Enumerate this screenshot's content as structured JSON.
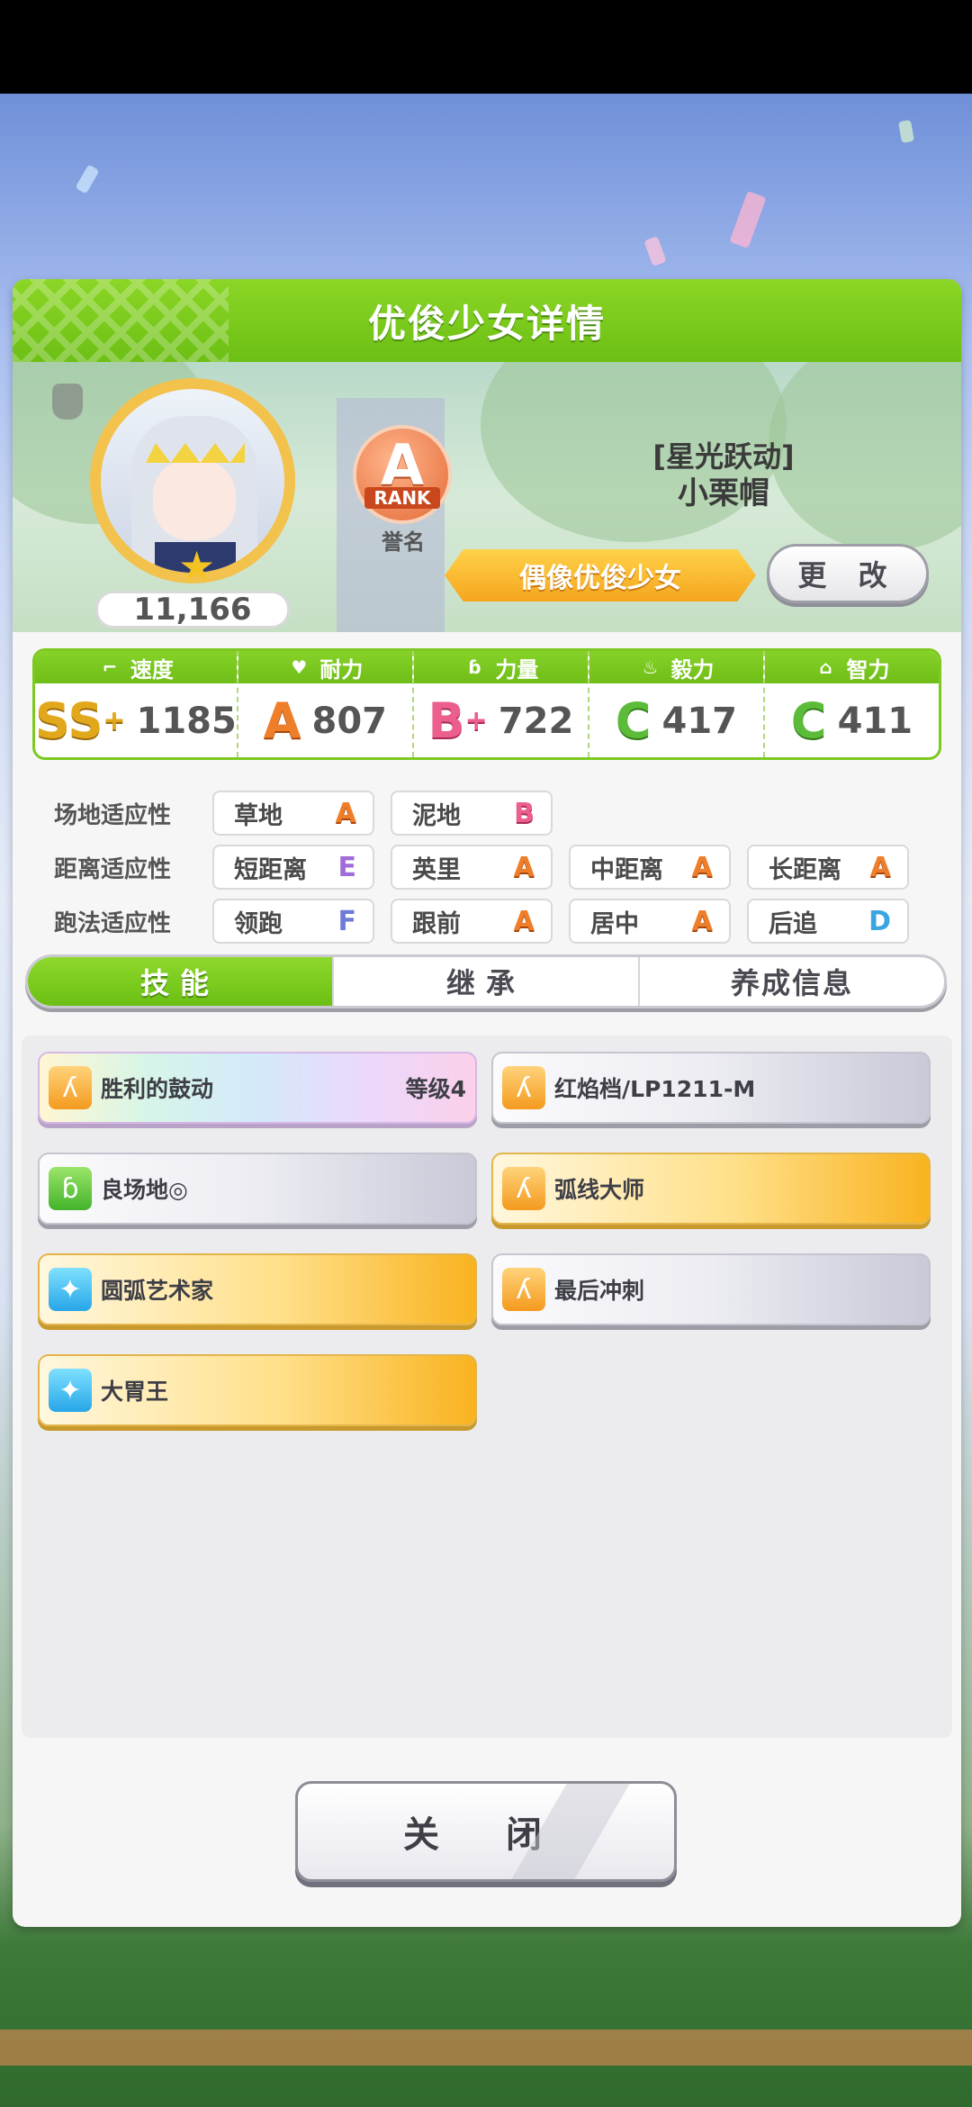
{
  "window": {
    "title": "优俊少女详情"
  },
  "character": {
    "fans": "11,166",
    "rank_grade": "A",
    "rank_word": "RANK",
    "rank_label": "誉名",
    "epithet": "[星光跃动]",
    "name": "小栗帽",
    "title_plate": "偶像优俊少女",
    "change_label": "更 改"
  },
  "stats": [
    {
      "label": "速度",
      "icon": "shoe-icon",
      "grade": "SS",
      "plus": "+",
      "value": "1185"
    },
    {
      "label": "耐力",
      "icon": "heart-icon",
      "grade": "A",
      "plus": "",
      "value": "807"
    },
    {
      "label": "力量",
      "icon": "muscle-icon",
      "grade": "B",
      "plus": "+",
      "value": "722"
    },
    {
      "label": "毅力",
      "icon": "flame-icon",
      "grade": "C",
      "plus": "",
      "value": "417"
    },
    {
      "label": "智力",
      "icon": "graduation-cap-icon",
      "grade": "C",
      "plus": "",
      "value": "411"
    }
  ],
  "aptitudes": {
    "track": {
      "label": "场地适应性",
      "items": [
        {
          "name": "草地",
          "grade": "A"
        },
        {
          "name": "泥地",
          "grade": "B"
        }
      ]
    },
    "distance": {
      "label": "距离适应性",
      "items": [
        {
          "name": "短距离",
          "grade": "E"
        },
        {
          "name": "英里",
          "grade": "A"
        },
        {
          "name": "中距离",
          "grade": "A"
        },
        {
          "name": "长距离",
          "grade": "A"
        }
      ]
    },
    "style": {
      "label": "跑法适应性",
      "items": [
        {
          "name": "领跑",
          "grade": "F"
        },
        {
          "name": "跟前",
          "grade": "A"
        },
        {
          "name": "居中",
          "grade": "A"
        },
        {
          "name": "后追",
          "grade": "D"
        }
      ]
    }
  },
  "tabs": [
    {
      "label": "技能",
      "active": true
    },
    {
      "label": "继承",
      "active": false
    },
    {
      "label": "养成信息",
      "active": false
    }
  ],
  "skills": [
    {
      "name": "胜利的鼓动",
      "level": "等级4",
      "style": "rainbow",
      "icon": "running-figure-icon",
      "icon_color": "orange"
    },
    {
      "name": "红焰档/LP1211-M",
      "level": "",
      "style": "gray",
      "icon": "running-figure-icon",
      "icon_color": "orange"
    },
    {
      "name": "良场地◎",
      "level": "",
      "style": "gray",
      "icon": "muscle-icon",
      "icon_color": "green"
    },
    {
      "name": "弧线大师",
      "level": "",
      "style": "gold",
      "icon": "running-figure-icon",
      "icon_color": "orange"
    },
    {
      "name": "圆弧艺术家",
      "level": "",
      "style": "gold",
      "icon": "sparkle-icon",
      "icon_color": "blue"
    },
    {
      "name": "最后冲刺",
      "level": "",
      "style": "gray",
      "icon": "running-figure-icon",
      "icon_color": "orange"
    },
    {
      "name": "大胃王",
      "level": "",
      "style": "gold",
      "icon": "sparkle-icon",
      "icon_color": "blue"
    }
  ],
  "close_label": "关 闭"
}
